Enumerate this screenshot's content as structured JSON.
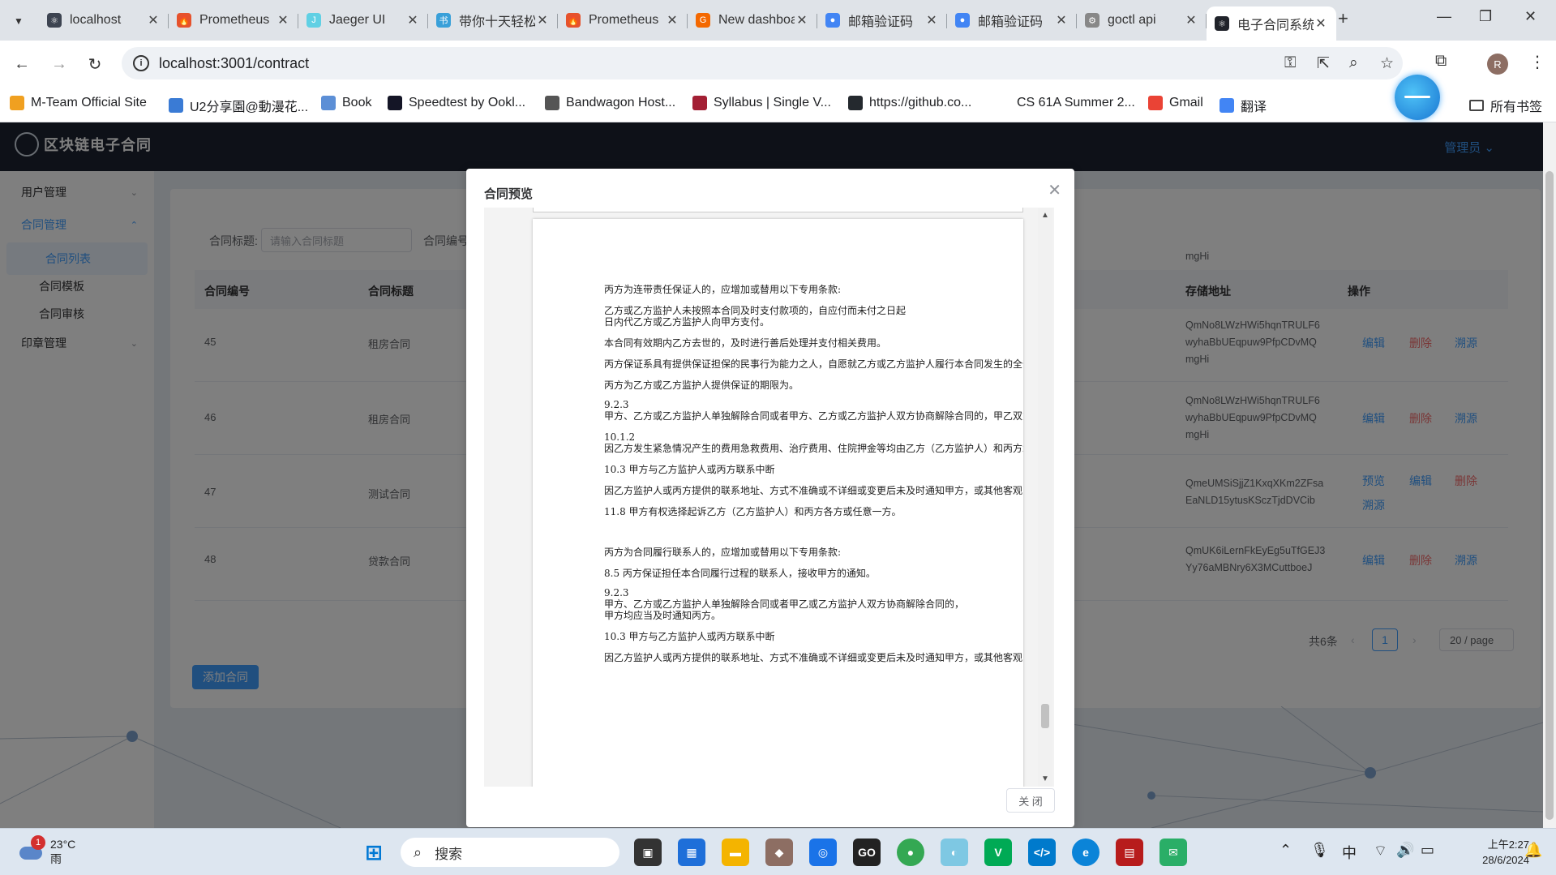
{
  "browser": {
    "tabs": [
      {
        "title": "localhost",
        "color": "#3d4451",
        "glyph": "⚛"
      },
      {
        "title": "Prometheus",
        "color": "#e6522c",
        "glyph": "🔥"
      },
      {
        "title": "Jaeger UI",
        "color": "#60d0e4",
        "glyph": "J"
      },
      {
        "title": "带你十天轻松",
        "color": "#39a0d9",
        "glyph": "书"
      },
      {
        "title": "Prometheus",
        "color": "#e6522c",
        "glyph": "🔥"
      },
      {
        "title": "New dashboard",
        "color": "#f46800",
        "glyph": "G"
      },
      {
        "title": "邮箱验证码",
        "color": "#4285f4",
        "glyph": "●"
      },
      {
        "title": "邮箱验证码",
        "color": "#4285f4",
        "glyph": "●"
      },
      {
        "title": "goctl api",
        "color": "#888888",
        "glyph": "⚙"
      },
      {
        "title": "电子合同系统",
        "color": "#20232a",
        "glyph": "⚛"
      }
    ],
    "url": "localhost:3001/contract",
    "profile_initial": "R",
    "bookmarks": [
      {
        "label": "M-Team Official Site",
        "color": "#f0a020"
      },
      {
        "label": "U2分享園@動漫花...",
        "color": "#3a7bd5"
      },
      {
        "label": "Book",
        "color": "#5c8fd6"
      },
      {
        "label": "Speedtest by Ookl...",
        "color": "#141526"
      },
      {
        "label": "Bandwagon Host...",
        "color": "#555555"
      },
      {
        "label": "Syllabus | Single V...",
        "color": "#a31f34"
      },
      {
        "label": "https://github.co...",
        "color": "#24292e"
      },
      {
        "label": "CS 61A Summer 2...",
        "color": "#ffffff"
      },
      {
        "label": "Gmail",
        "color": "#ea4335"
      },
      {
        "label": "翻译",
        "color": "#4285f4"
      }
    ],
    "all_bookmarks": "所有书签"
  },
  "app": {
    "logo_text": "区块链电子合同",
    "admin": "管理员",
    "menu": {
      "user_mgmt": "用户管理",
      "contract_mgmt": "合同管理",
      "contract_list": "合同列表",
      "contract_template": "合同模板",
      "contract_review": "合同审核",
      "seal_mgmt": "印章管理"
    },
    "filter": {
      "title_label": "合同标题:",
      "title_placeholder": "请输入合同标题",
      "number_label": "合同编号"
    },
    "table": {
      "headers": [
        "合同编号",
        "合同标题",
        "存储地址",
        "操作"
      ],
      "partial_addr_top": "mgHi",
      "rows": [
        {
          "id": "45",
          "title": "租房合同",
          "addr": [
            "QmNo8LWzHWi5hqnTRULF6",
            "wyhaBbUEqpuw9PfpCDvMQ",
            "mgHi"
          ],
          "actions": [
            "编辑",
            "删除",
            "溯源"
          ]
        },
        {
          "id": "46",
          "title": "租房合同",
          "addr": [
            "QmNo8LWzHWi5hqnTRULF6",
            "wyhaBbUEqpuw9PfpCDvMQ",
            "mgHi"
          ],
          "actions": [
            "编辑",
            "删除",
            "溯源"
          ]
        },
        {
          "id": "47",
          "title": "测试合同",
          "addr": [
            "QmeUMSiSjjZ1KxqXKm2ZFsa",
            "EaNLD15ytusKSczTjdDVCib"
          ],
          "actions": [
            "预览",
            "编辑",
            "删除",
            "溯源"
          ]
        },
        {
          "id": "48",
          "title": "贷款合同",
          "addr": [
            "QmUK6iLernFkEyEg5uTfGEJ3",
            "Yy76aMBNry6X3MCuttboeJ"
          ],
          "actions": [
            "编辑",
            "删除",
            "溯源"
          ]
        }
      ]
    },
    "add_button": "添加合同",
    "pagination": {
      "total": "共6条",
      "current": "1",
      "page_size": "20 / page"
    }
  },
  "dialog": {
    "title": "合同预览",
    "close_button": "关 闭",
    "paragraphs": [
      "丙方为连带责任保证人的，应增加或替用以下专用条款:",
      "乙方或乙方监护人未按照本合同及时支付款项的，自应付而未付之日起",
      "日内代乙方或乙方监护人向甲方支付。",
      "本合同有效期内乙方去世的，及时进行善后处理并支付相关费用。",
      "丙方保证系具有提供保证担保的民事行为能力之人，自愿就乙方或乙方监护人履行本合同发生的全部",
      "丙方为乙方或乙方监护人提供保证的期限为。",
      "9.2.3",
      "甲方、乙方或乙方监护人单独解除合同或者甲方、乙方或乙方监护人双方协商解除合同的，甲乙双方",
      "10.1.2",
      "因乙方发生紧急情况产生的费用急救费用、治疗费用、住院押金等均由乙方（乙方监护人）和丙方承担",
      "10.3 甲方与乙方监护人或丙方联系中断",
      "因乙方监护人或丙方提供的联系地址、方式不准确或不详细或变更后未及时通知甲方，或其他客观",
      "11.8 甲方有权选择起诉乙方（乙方监护人）和丙方各方或任意一方。",
      "丙方为合同履行联系人的，应增加或替用以下专用条款:",
      "8.5 丙方保证担任本合同履行过程的联系人，接收甲方的通知。",
      "9.2.3",
      "甲方、乙方或乙方监护人单独解除合同或者甲乙或乙方监护人双方协商解除合同的，",
      "甲方均应当及时通知丙方。",
      "10.3 甲方与乙方监护人或丙方联系中断",
      "因乙方监护人或丙方提供的联系地址、方式不准确或不详细或变更后未及时通知甲方，或其他客观"
    ]
  },
  "taskbar": {
    "weather_temp": "23°C",
    "weather_desc": "雨",
    "weather_badge": "1",
    "search_placeholder": "搜索",
    "ime": "中",
    "time": "上午2:27",
    "date": "28/6/2024"
  }
}
